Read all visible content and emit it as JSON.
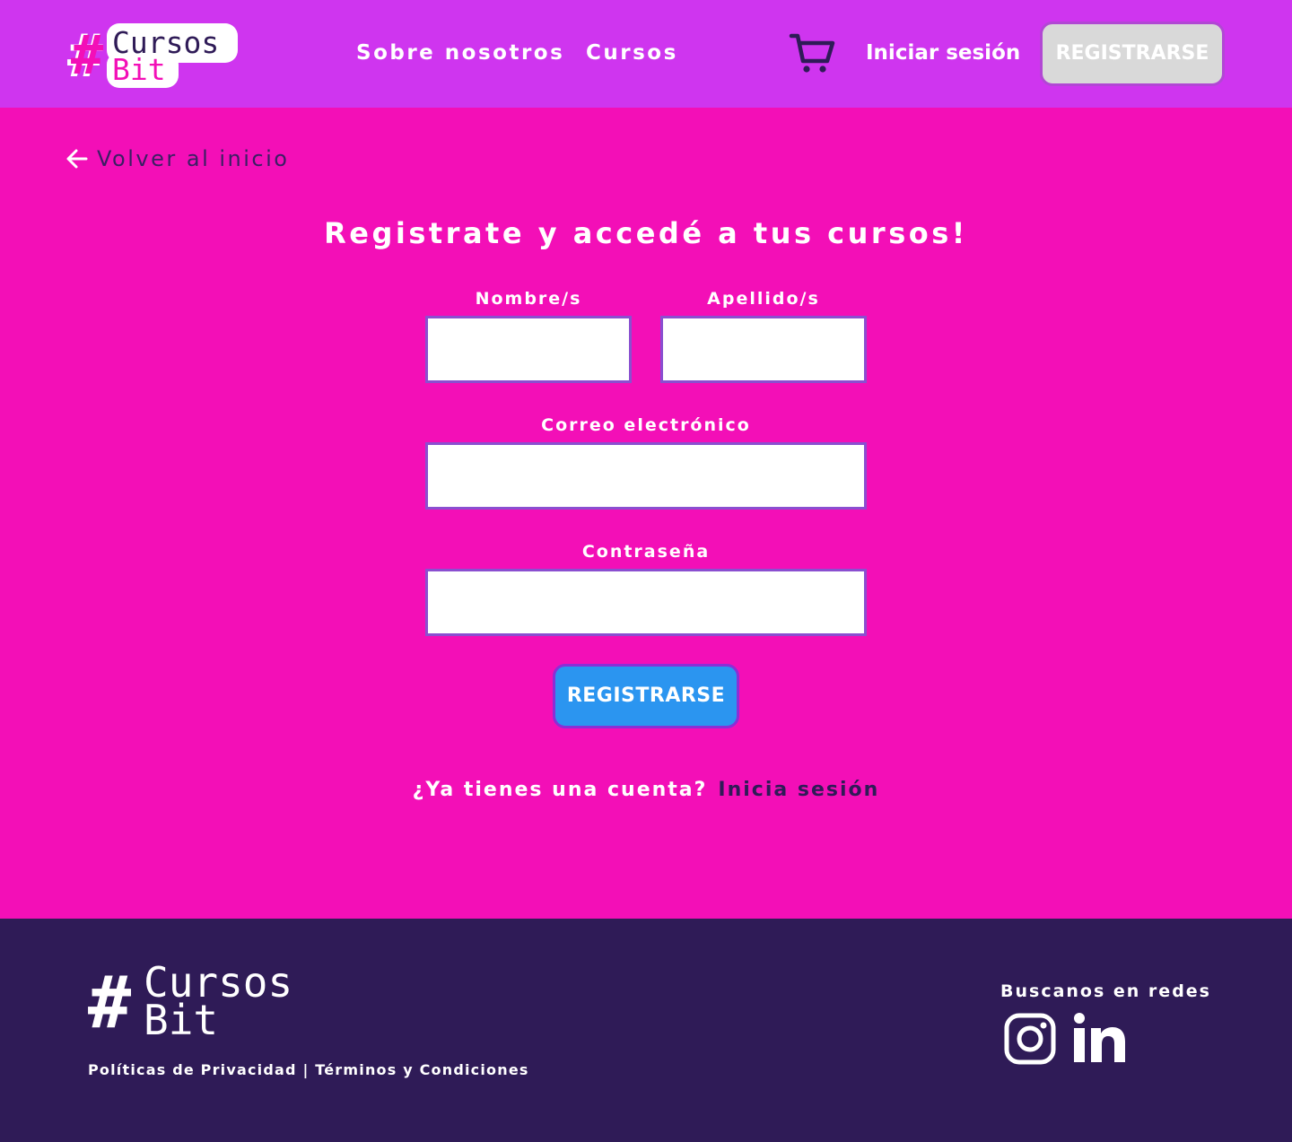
{
  "header": {
    "logo": {
      "line1": "Cursos",
      "line2": "Bit",
      "hash": "#"
    },
    "nav": [
      {
        "label": "Sobre nosotros"
      },
      {
        "label": "Cursos"
      }
    ],
    "cart_icon": "shopping-cart-icon",
    "login_label": "Iniciar sesión",
    "register_label": "REGISTRARSE"
  },
  "back": {
    "label": "Volver al inicio",
    "icon": "arrow-left-icon"
  },
  "form": {
    "title": "Registrate y accedé a tus cursos!",
    "first_name": {
      "label": "Nombre/s",
      "value": "",
      "placeholder": ""
    },
    "last_name": {
      "label": "Apellido/s",
      "value": "",
      "placeholder": ""
    },
    "email": {
      "label": "Correo electrónico",
      "value": "",
      "placeholder": ""
    },
    "password": {
      "label": "Contraseña",
      "value": "",
      "placeholder": ""
    },
    "submit_label": "REGISTRARSE",
    "have_account_text": "¿Ya tienes una cuenta?",
    "login_link": "Inicia sesión"
  },
  "footer": {
    "logo": {
      "line1": "Cursos",
      "line2": "Bit",
      "hash": "#"
    },
    "legal": "Políticas de Privacidad | Términos y Condiciones",
    "social_title": "Buscanos en redes",
    "social_icons": [
      "instagram-icon",
      "linkedin-icon"
    ]
  },
  "colors": {
    "header_bg": "#cf35ef",
    "page_bg": "#f30fb7",
    "footer_bg": "#2f1b57",
    "primary_button": "#2b95f0",
    "dark_text": "#2f1b57"
  }
}
